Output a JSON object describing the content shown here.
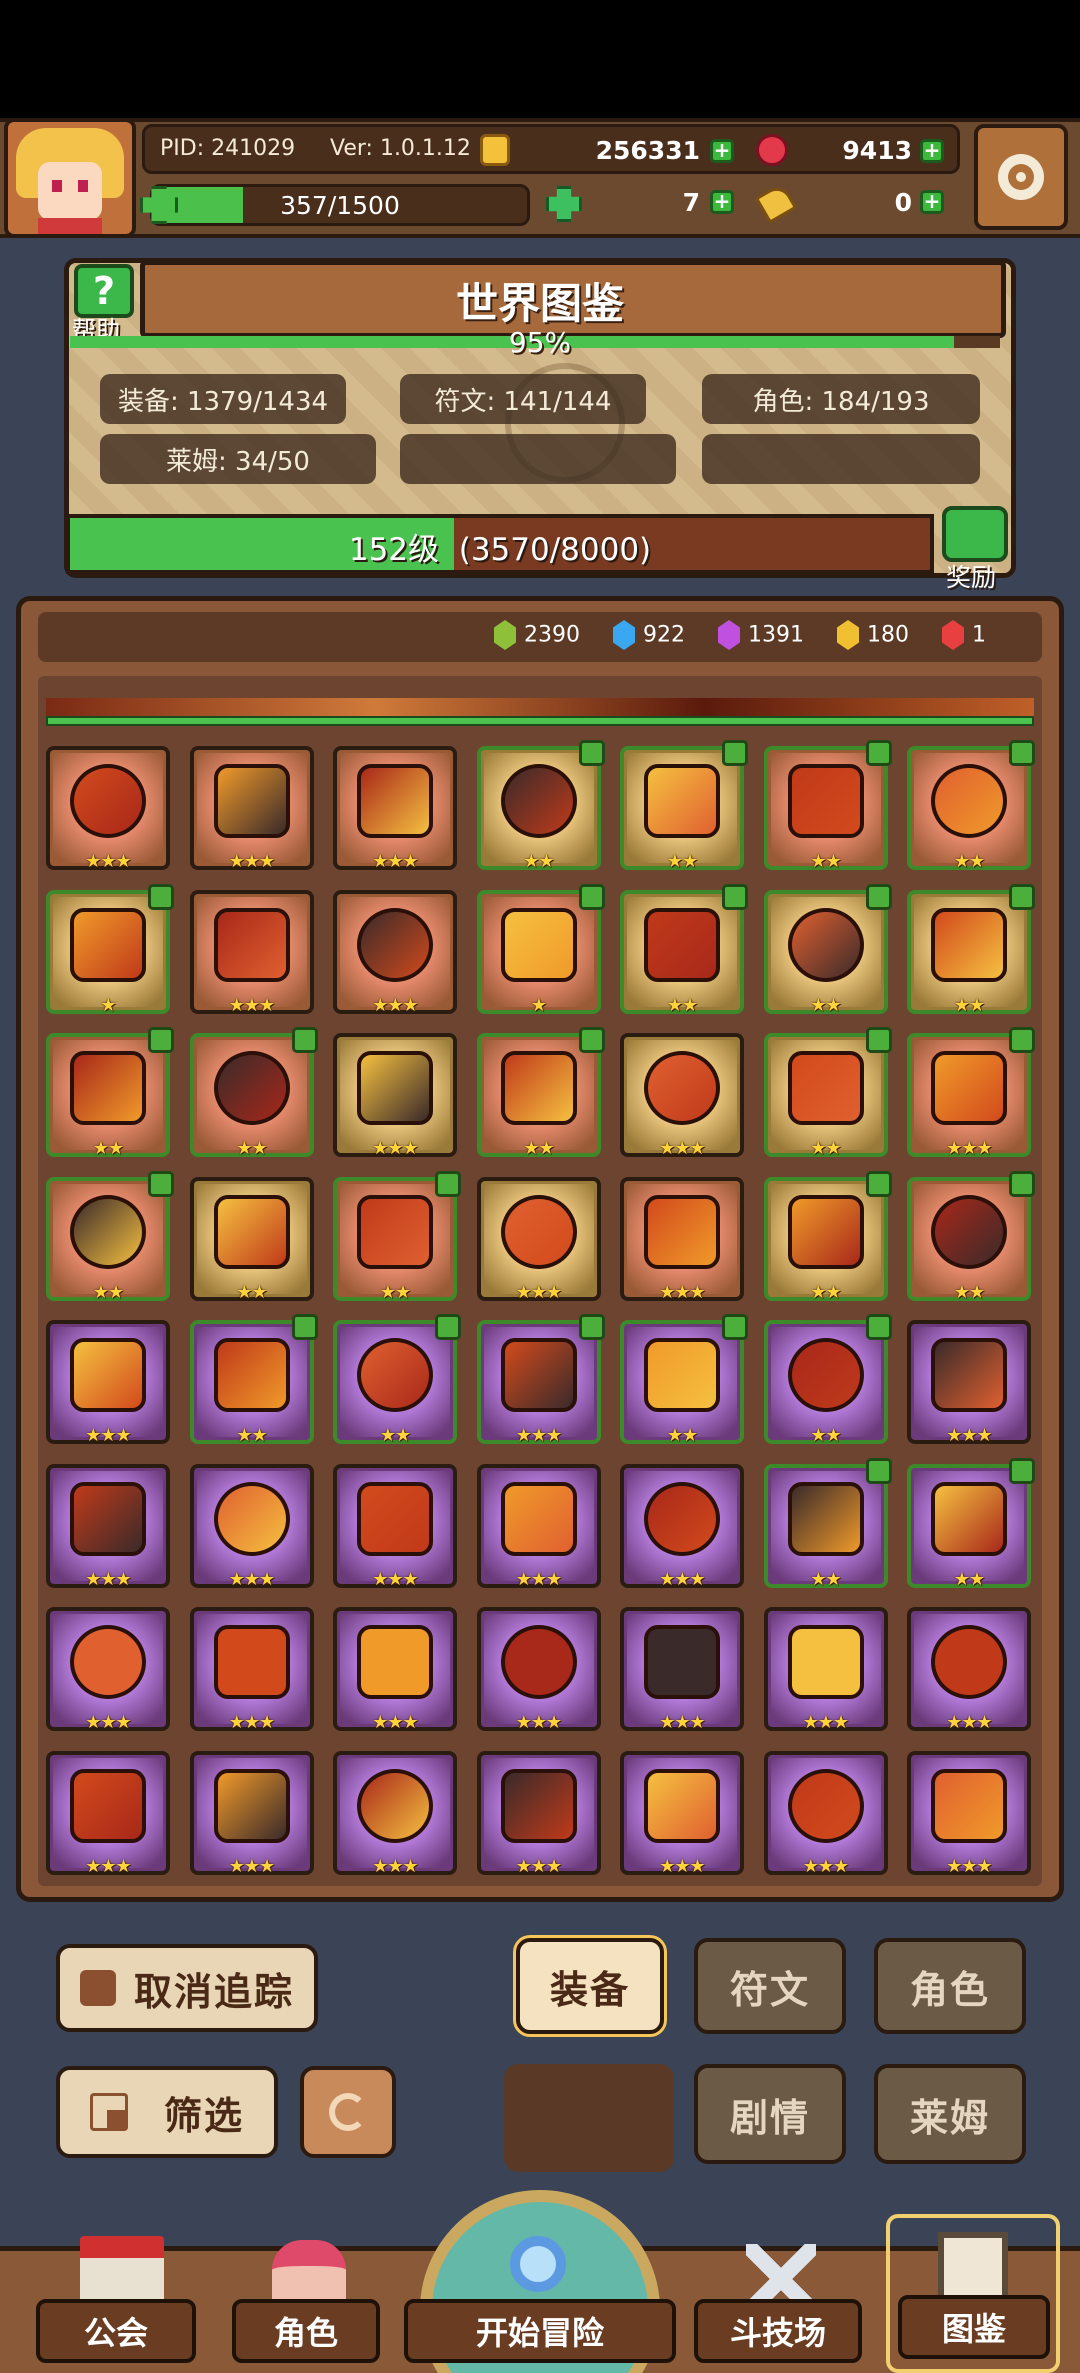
{
  "hud": {
    "pid": "PID: 241029",
    "version": "Ver: 1.0.1.12",
    "gold": "256331",
    "ruby": "9413",
    "stamina": "357/1500",
    "stamina_fraction": 0.24,
    "clover": "7",
    "key": "0"
  },
  "codex": {
    "title": "世界图鉴",
    "help_label": "帮助",
    "percent": "95%",
    "percent_value": 0.95,
    "stats": [
      "装备: 1379/1434",
      "符文: 141/144",
      "角色: 184/193",
      "莱姆: 34/50"
    ],
    "level": "152级  (3570/8000)",
    "level_fraction": 0.446,
    "reward_label": "奖励"
  },
  "gems": [
    {
      "color": "#8fc03a",
      "count": "2390"
    },
    {
      "color": "#3aa8f0",
      "count": "922"
    },
    {
      "color": "#c050e0",
      "count": "1391"
    },
    {
      "color": "#f0c030",
      "count": "180"
    },
    {
      "color": "#e84040",
      "count": "1"
    }
  ],
  "grid": {
    "rows": [
      {
        "bg": "red",
        "tiles": [
          {
            "item": "crossed-axes",
            "stars": "★★★",
            "tracked": false
          },
          {
            "item": "flame-armor",
            "stars": "★★★",
            "tracked": false
          },
          {
            "item": "lava-gauntlet",
            "stars": "★★★",
            "tracked": false
          },
          {
            "item": "dark-armor",
            "stars": "★★",
            "tracked": true,
            "bg": "gold"
          },
          {
            "item": "flame-sword",
            "stars": "★★",
            "tracked": true,
            "bg": "gold"
          },
          {
            "item": "magma-boots",
            "stars": "★★",
            "tracked": true
          },
          {
            "item": "dark-boots",
            "stars": "★★",
            "tracked": true
          }
        ]
      },
      {
        "bg": "gold",
        "tiles": [
          {
            "item": "fire-scepter",
            "stars": "★",
            "tracked": true
          },
          {
            "item": "star-amulet",
            "stars": "★★★",
            "tracked": false,
            "bg": "red"
          },
          {
            "item": "fire-ring",
            "stars": "★★★",
            "tracked": false,
            "bg": "red"
          },
          {
            "item": "scroll",
            "stars": "★",
            "tracked": true,
            "bg": "red"
          },
          {
            "item": "gold-ring",
            "stars": "★★",
            "tracked": true
          },
          {
            "item": "leather-boots",
            "stars": "★★",
            "tracked": true
          },
          {
            "item": "crossbow",
            "stars": "★★",
            "tracked": true
          }
        ]
      },
      {
        "bg": "red",
        "tiles": [
          {
            "item": "spear",
            "stars": "★★",
            "tracked": true
          },
          {
            "item": "ruby-ring",
            "stars": "★★",
            "tracked": true
          },
          {
            "item": "gold-gloves",
            "stars": "★★★",
            "tracked": false,
            "bg": "gold"
          },
          {
            "item": "gem-necklace",
            "stars": "★★",
            "tracked": true
          },
          {
            "item": "dragon-boots",
            "stars": "★★★",
            "tracked": false,
            "bg": "gold"
          },
          {
            "item": "fire-dagger",
            "stars": "★★",
            "tracked": true,
            "bg": "gold"
          },
          {
            "item": "lantern-armor",
            "stars": "★★★",
            "tracked": true
          }
        ]
      },
      {
        "bg": "red",
        "tiles": [
          {
            "item": "magma-gloves",
            "stars": "★★",
            "tracked": true
          },
          {
            "item": "sun-wand",
            "stars": "★★",
            "tracked": false,
            "bg": "gold"
          },
          {
            "item": "fire-orb",
            "stars": "★★",
            "tracked": true
          },
          {
            "item": "phoenix-armor",
            "stars": "★★★",
            "tracked": false,
            "bg": "gold"
          },
          {
            "item": "flame-helm",
            "stars": "★★★",
            "tracked": false
          },
          {
            "item": "gold-gloves-2",
            "stars": "★★",
            "tracked": true,
            "bg": "gold"
          },
          {
            "item": "heart-amulet",
            "stars": "★★",
            "tracked": true
          }
        ]
      },
      {
        "bg": "purple",
        "tiles": [
          {
            "item": "fire-whip",
            "stars": "★★★",
            "tracked": false
          },
          {
            "item": "red-scroll",
            "stars": "★★",
            "tracked": true
          },
          {
            "item": "sun-shield",
            "stars": "★★",
            "tracked": true
          },
          {
            "item": "gold-armor",
            "stars": "★★★",
            "tracked": true
          },
          {
            "item": "gold-boots",
            "stars": "★★",
            "tracked": true
          },
          {
            "item": "gold-helm",
            "stars": "★★",
            "tracked": true
          },
          {
            "item": "gold-sword",
            "stars": "★★★",
            "tracked": false
          }
        ]
      },
      {
        "bg": "purple",
        "tiles": [
          {
            "item": "fire-shield",
            "stars": "★★★",
            "tracked": false
          },
          {
            "item": "sun-armor",
            "stars": "★★★",
            "tracked": false
          },
          {
            "item": "long-bow",
            "stars": "★★★",
            "tracked": false
          },
          {
            "item": "pendant",
            "stars": "★★★",
            "tracked": false
          },
          {
            "item": "crystal-ring",
            "stars": "★★★",
            "tracked": false
          },
          {
            "item": "lotus-shield",
            "stars": "★★",
            "tracked": true
          },
          {
            "item": "flame-necklace",
            "stars": "★★",
            "tracked": true
          }
        ]
      },
      {
        "bg": "purple",
        "tiles": [
          {
            "item": "dark-ring",
            "stars": "★★★",
            "tracked": false
          },
          {
            "item": "ember-shield",
            "stars": "★★★",
            "tracked": false
          },
          {
            "item": "demon-helm",
            "stars": "★★★",
            "tracked": false
          },
          {
            "item": "demon-armor",
            "stars": "★★★",
            "tracked": false
          },
          {
            "item": "obsidian-armor",
            "stars": "★★★",
            "tracked": false
          },
          {
            "item": "obsidian-helm",
            "stars": "★★★",
            "tracked": false
          },
          {
            "item": "obsidian-plate",
            "stars": "★★★",
            "tracked": false
          }
        ]
      },
      {
        "bg": "purple",
        "tiles": [
          {
            "item": "ruby-gem",
            "stars": "★★★",
            "tracked": false
          },
          {
            "item": "heart-chain",
            "stars": "★★★",
            "tracked": false
          },
          {
            "item": "lava-helm",
            "stars": "★★★",
            "tracked": false
          },
          {
            "item": "gold-scroll",
            "stars": "★★★",
            "tracked": false
          },
          {
            "item": "gold-band",
            "stars": "★★★",
            "tracked": false
          },
          {
            "item": "gold-greaves",
            "stars": "★★★",
            "tracked": false
          },
          {
            "item": "fire-blade",
            "stars": "★★★",
            "tracked": false
          }
        ]
      }
    ]
  },
  "controls": {
    "untrack": "取消追踪",
    "filter": "筛选",
    "tab_equipment": "装备",
    "tab_rune": "符文",
    "tab_character": "角色",
    "tab_story": "剧情",
    "tab_slime": "莱姆"
  },
  "nav": {
    "guild": "公会",
    "character": "角色",
    "adventure": "开始冒险",
    "arena": "斗技场",
    "codex": "图鉴"
  }
}
